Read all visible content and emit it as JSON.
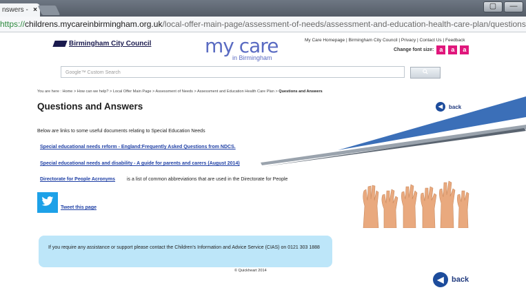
{
  "browser": {
    "tab_title": "nswers -",
    "tab_close": "×",
    "url_scheme": "https://",
    "url_host": "childrens.mycareinbirmingham.org.uk",
    "url_path": "/local-offer-main-page/assessment-of-needs/assessment-and-education-health-care-plan/questions-and-answers.aspx",
    "window_buttons": [
      "▢",
      "—"
    ]
  },
  "header": {
    "council_name": "Birmingham City Council",
    "mycare_logo": "my care",
    "mycare_sub": "in Birmingham",
    "top_links": "My Care Homepage | Birmingham City Council | Privacy | Contact Us | Feedback",
    "font_size_label": "Change font size:",
    "font_size_options": [
      "a",
      "a",
      "a"
    ]
  },
  "search": {
    "placeholder": "Google™ Custom Search",
    "button_icon": "search-icon"
  },
  "breadcrumb": {
    "items": "You are here : Home > How can we help? > Local Offer Main Page > Assessment of Needs > Assessment and Education Health Care Plan > ",
    "current": "Questions and Answers"
  },
  "page": {
    "title": "Questions and Answers",
    "back_label": "back",
    "intro": "Below are links to some useful documents relating to Special Education Needs",
    "links": [
      "Special educational needs reform - England:Frequently Asked Questions from NDCS.",
      "Special educational needs and disability - A guide for parents and carers (August 2014)",
      "Directorate for People Acronyms"
    ],
    "acronyms_desc": "is a list of common abbreviations that are used in the Directorate for People",
    "tweet_label": "Tweet this page",
    "info_text": "If you require any assistance or support please contact the Children's Information and Advice Service (CIAS) on 0121 303 1888",
    "copyright": "© Quickheart 2014",
    "back_bottom_label": "back"
  },
  "colors": {
    "accent_pink": "#e0177c",
    "link_blue": "#1e3fa5",
    "info_bg": "#bde6f9",
    "twitter_blue": "#1da1e8"
  }
}
